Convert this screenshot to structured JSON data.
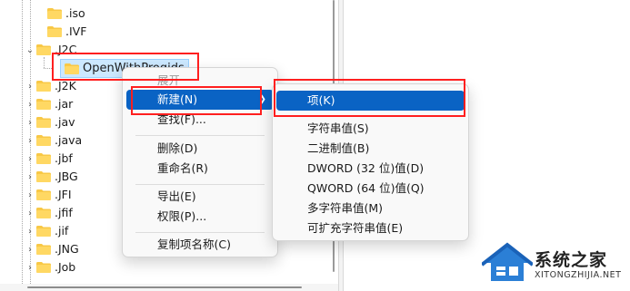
{
  "tree": {
    "items": [
      {
        "label": ".iso",
        "chevron": "›"
      },
      {
        "label": ".IVF",
        "chevron": "›"
      },
      {
        "label": ".J2C",
        "chevron": "⌄"
      },
      {
        "label": "OpenWithProgids",
        "chevron": ""
      },
      {
        "label": ".J2K",
        "chevron": "›"
      },
      {
        "label": ".jar",
        "chevron": "›"
      },
      {
        "label": ".jav",
        "chevron": "›"
      },
      {
        "label": ".java",
        "chevron": "›"
      },
      {
        "label": ".jbf",
        "chevron": "›"
      },
      {
        "label": ".JBG",
        "chevron": "›"
      },
      {
        "label": ".JFI",
        "chevron": "›"
      },
      {
        "label": ".jfif",
        "chevron": "›"
      },
      {
        "label": ".jif",
        "chevron": "›"
      },
      {
        "label": ".JNG",
        "chevron": "›"
      },
      {
        "label": ".Job",
        "chevron": "›"
      }
    ]
  },
  "context_menu": {
    "expand": "展开",
    "new": "新建(N)",
    "find": "查找(F)...",
    "delete": "删除(D)",
    "rename": "重命名(R)",
    "export": "导出(E)",
    "permissions": "权限(P)...",
    "copy_key_name": "复制项名称(C)"
  },
  "submenu": {
    "key": "项(K)",
    "string_value": "字符串值(S)",
    "binary_value": "二进制值(B)",
    "dword_value": "DWORD (32 位)值(D)",
    "qword_value": "QWORD (64 位)值(Q)",
    "multi_string_value": "多字符串值(M)",
    "expandable_string_value": "可扩充字符串值(E)"
  },
  "watermark": {
    "title": "系统之家",
    "url": "XITONGZHIJIA.NET"
  },
  "colors": {
    "highlight": "#0a63c4",
    "annotation_red": "#ff1f1f",
    "folder_yellow": "#f8c846"
  }
}
